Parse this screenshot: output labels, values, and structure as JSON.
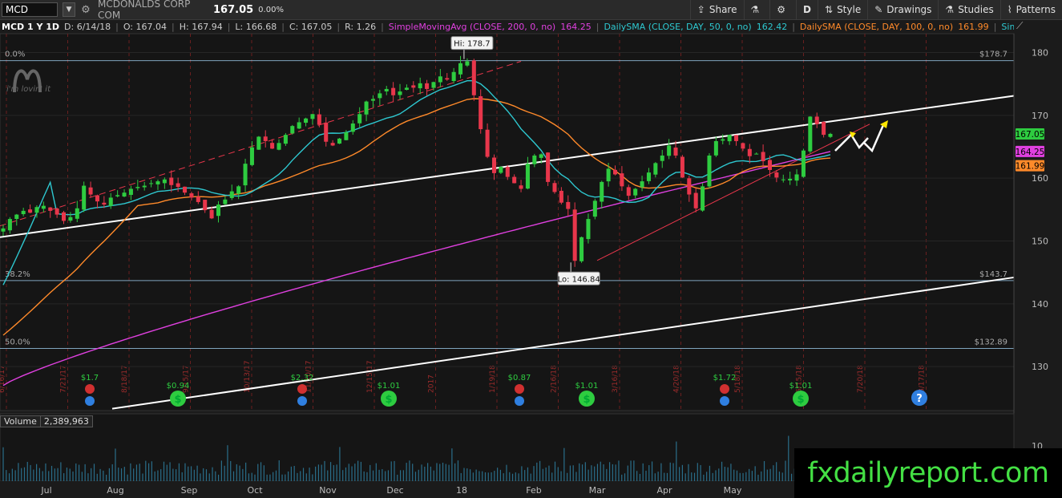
{
  "toolbar": {
    "symbol": "MCD",
    "company": "MCDONALDS CORP COM",
    "last_price": "167.05",
    "change_pct": "0.00%",
    "buttons": [
      {
        "label": "Share",
        "icon": "share-icon"
      },
      {
        "label": "",
        "icon": "flask-icon"
      },
      {
        "label": "",
        "icon": "gear-icon"
      },
      {
        "label": "D",
        "icon": ""
      },
      {
        "label": "Style",
        "icon": "style-icon"
      },
      {
        "label": "Drawings",
        "icon": "drawings-icon"
      },
      {
        "label": "Studies",
        "icon": "studies-icon"
      },
      {
        "label": "Patterns",
        "icon": "patterns-icon"
      }
    ]
  },
  "infobar": {
    "title": "MCD 1 Y 1D",
    "date": "D: 6/14/18",
    "open": "O: 167.04",
    "high": "H: 167.94",
    "low": "L: 166.68",
    "close": "C: 167.05",
    "range": "R: 1.26",
    "studies": [
      {
        "label": "SimpleMovingAvg (CLOSE, 200, 0, no)",
        "value": "164.25",
        "color": "#e040e0"
      },
      {
        "label": "DailySMA (CLOSE, DAY, 50, 0, no)",
        "value": "162.42",
        "color": "#2ec8d0"
      },
      {
        "label": "DailySMA (CLOSE, DAY, 100, 0, no)",
        "value": "161.99",
        "color": "#ff8a2a"
      },
      {
        "label": "SimpleMovingAvg (CLOSE, 50,...",
        "value": "",
        "color": "#2ec8d0"
      }
    ]
  },
  "logo": {
    "text": "i'm lovin' it"
  },
  "colors": {
    "up": "#2ecc40",
    "down": "#e8364b",
    "sma200": "#e040e0",
    "sma50": "#2ec8d0",
    "sma100": "#ff8a2a",
    "grid": "#2e2e2e",
    "fib": "#9ac8e8"
  },
  "chart_data": {
    "type": "candlestick",
    "y_axis": {
      "ticks": [
        130,
        140,
        150,
        160,
        170,
        180
      ],
      "range": [
        123,
        183
      ]
    },
    "x_axis": {
      "labels": [
        "Jul",
        "Aug",
        "Sep",
        "Oct",
        "Nov",
        "Dec",
        "18",
        "Feb",
        "Mar",
        "Apr",
        "May"
      ]
    },
    "price_badges": [
      {
        "value": "167.05",
        "color": "#2ecc40"
      },
      {
        "value": "164.25",
        "color": "#e040e0"
      },
      {
        "value": "161.99",
        "color": "#ff8a2a"
      }
    ],
    "annotations": {
      "high": {
        "label": "Hi: 178.7",
        "value": 178.7
      },
      "low": {
        "label": "Lo: 146.84",
        "value": 146.84
      }
    },
    "fibonacci": [
      {
        "label": "0.0%",
        "right_label": "$178.7",
        "value": 178.7
      },
      {
        "label": "38.2%",
        "right_label": "$143.7",
        "value": 143.7
      },
      {
        "label": "50.0%",
        "right_label": "$132.89",
        "value": 132.89
      }
    ],
    "event_labels": [
      {
        "label": "$1.7"
      },
      {
        "label": "$0.94"
      },
      {
        "label": "$2.32"
      },
      {
        "label": "$1.01"
      },
      {
        "label": "$0.87"
      },
      {
        "label": "$1.01"
      },
      {
        "label": "$1.72"
      },
      {
        "label": "$1.01"
      }
    ],
    "date_labels": [
      "6/16/17",
      "7/21/17",
      "8/18/17",
      "9/15/17",
      "10/13/17",
      "11/10/17",
      "12/15/17",
      "2017",
      "1/19/18",
      "2/16/18",
      "3/16/18",
      "4/20/18",
      "5/18/18",
      "6/15/18",
      "7/20/18",
      "8/17/18"
    ],
    "volume": {
      "label": "Volume",
      "value": "2,389,963",
      "axis_tick": "10"
    },
    "close_series": [
      152,
      153.5,
      154.2,
      154.8,
      154.5,
      155.4,
      155.6,
      154.8,
      154.2,
      153.2,
      153.8,
      155.2,
      158.8,
      157.4,
      156.3,
      155.8,
      156.9,
      157.3,
      157.7,
      158.3,
      158.6,
      158.8,
      159.2,
      159.5,
      159.8,
      158.9,
      158.6,
      157.7,
      156.9,
      156.2,
      154.9,
      153.6,
      155.8,
      156.6,
      157.9,
      158.7,
      162.3,
      164.9,
      166.6,
      165.9,
      164.7,
      165.6,
      166.9,
      168.3,
      168.9,
      169.5,
      170.2,
      168.5,
      165.8,
      165.2,
      166.3,
      167.3,
      168.7,
      170.2,
      172.2,
      172.6,
      173.5,
      174.2,
      173.2,
      173.8,
      174.4,
      174.4,
      175.1,
      174.2,
      175.3,
      176.2,
      175.7,
      176.9,
      178.3,
      178.6,
      173.2,
      167.8,
      163.4,
      160.8,
      161.8,
      160.2,
      159.2,
      158.3,
      162.3,
      163.6,
      163.8,
      159.4,
      157.8,
      156.1,
      155.1,
      146.84,
      150.6,
      153.5,
      156.4,
      159.4,
      161.5,
      160.6,
      158.7,
      157.2,
      158.3,
      159.5,
      160.9,
      162.4,
      163.6,
      165.2,
      163.6,
      160.1,
      157.4,
      155.2,
      158.7,
      163.6,
      165.9,
      166.2,
      166.9,
      165.9,
      164.7,
      163.5,
      163.9,
      162.7,
      161.3,
      160.1,
      159.8,
      159.9,
      160.6,
      164.4,
      169.8,
      168.6,
      166.9,
      167.05
    ]
  }
}
